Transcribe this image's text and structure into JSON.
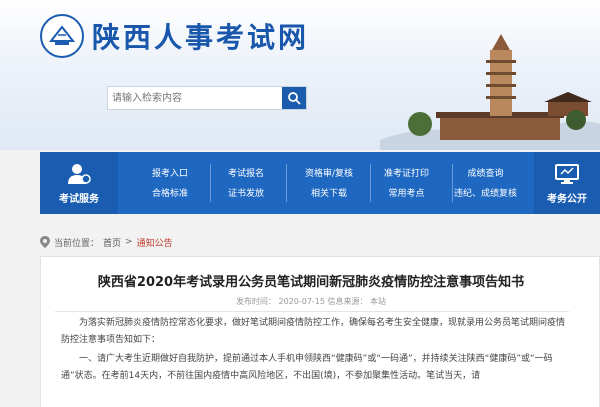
{
  "header": {
    "site_title": "陕西人事考试网",
    "search_placeholder": "请输入检索内容"
  },
  "nav": {
    "left_caption": "考试服务",
    "right_caption": "考务公开",
    "columns": [
      {
        "top": "报考入口",
        "bottom": "合格标准"
      },
      {
        "top": "考试报名",
        "bottom": "证书发放"
      },
      {
        "top": "资格审/复核",
        "bottom": "相关下载"
      },
      {
        "top": "准考证打印",
        "bottom": "常用考点"
      },
      {
        "top": "成绩查询",
        "bottom": "违纪、成绩复核"
      }
    ]
  },
  "breadcrumb": {
    "label": "当前位置：",
    "home": "首页",
    "separator": ">",
    "current": "通知公告"
  },
  "article": {
    "title": "陕西省2020年考试录用公务员笔试期间新冠肺炎疫情防控注意事项告知书",
    "meta": "发布时间： 2020-07-15    信息来源： 本站",
    "paragraph1": "为落实新冠肺炎疫情防控常态化要求，做好笔试期间疫情防控工作，确保每名考生安全健康，现就录用公务员笔试期间疫情防控注意事项告知如下：",
    "paragraph2": "一、请广大考生近期做好自我防护，提前通过本人手机申领陕西“健康码”或“一码通”，并持续关注陕西“健康码”或“一码通”状态。在考前14天内，不前往国内疫情中高风险地区，不出国(境)，不参加聚集性活动。笔试当天，请"
  }
}
